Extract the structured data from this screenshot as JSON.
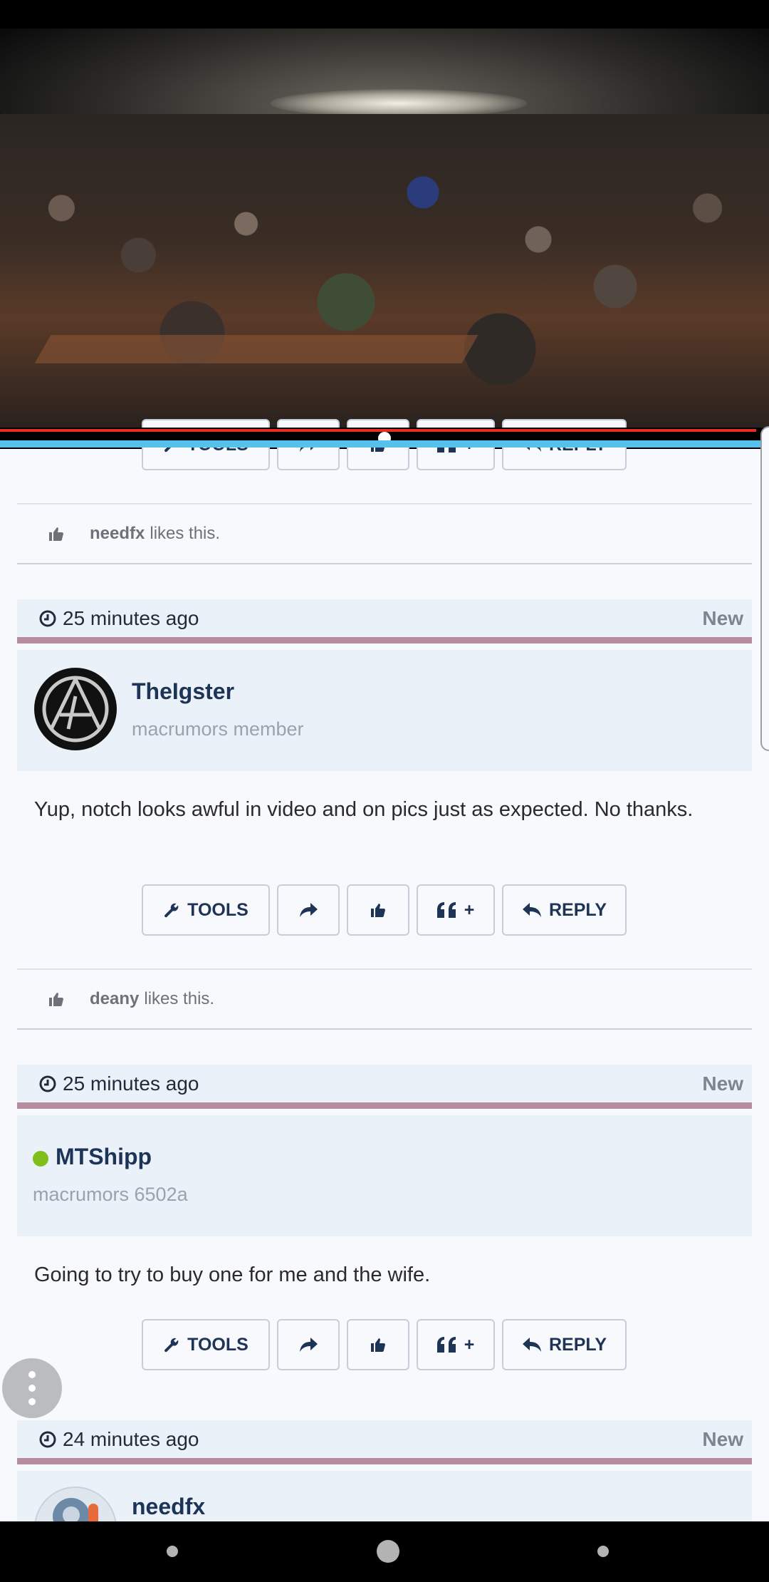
{
  "video": {
    "progress": 0.98
  },
  "buttons": {
    "tools": "TOOLS",
    "quote": "+",
    "reply": "REPLY"
  },
  "likes": [
    {
      "user": "needfx",
      "text": "likes this."
    },
    {
      "user": "deany",
      "text": "likes this."
    }
  ],
  "posts": [
    {
      "time": "25 minutes ago",
      "badge": "New",
      "username": "TheIgster",
      "usertitle": "macrumors member",
      "body": "Yup, notch looks awful in video and on pics just as expected. No thanks."
    },
    {
      "time": "25 minutes ago",
      "badge": "New",
      "username": "MTShipp",
      "usertitle": "macrumors 6502a",
      "online": true,
      "body": "Going to try to buy one for me and the wife."
    },
    {
      "time": "24 minutes ago",
      "badge": "New",
      "username": "needfx"
    }
  ],
  "colors": {
    "accent": "#1d3456",
    "header_border": "#b78c9f",
    "header_bg": "#eaf1f9",
    "online": "#7fbf1c",
    "progress": "#e52d27",
    "blue_bar": "#54c2ec"
  }
}
